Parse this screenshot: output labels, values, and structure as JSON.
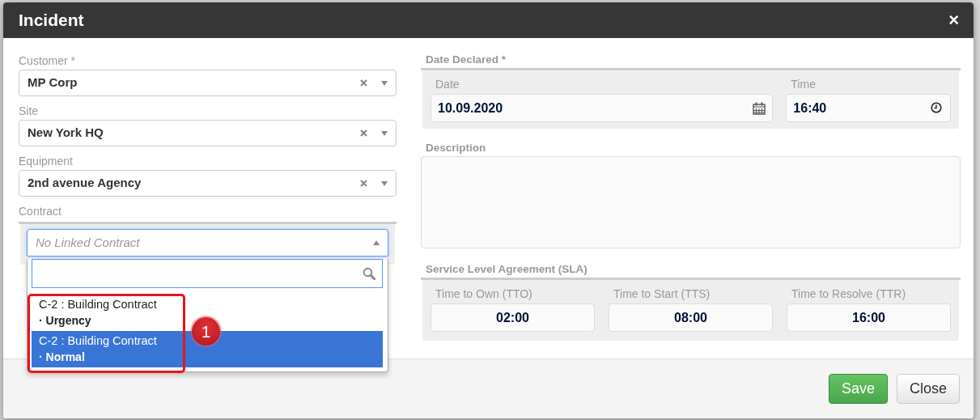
{
  "dialog": {
    "title": "Incident",
    "close_glyph": "×"
  },
  "left_fields": [
    {
      "label": "Customer *",
      "value": "MP Corp"
    },
    {
      "label": "Site",
      "value": "New York HQ"
    },
    {
      "label": "Equipment",
      "value": "2nd avenue Agency"
    }
  ],
  "contract": {
    "label": "Contract",
    "placeholder": "No Linked Contract",
    "expanded": true,
    "options": [
      {
        "name": "C-2 : Building Contract",
        "priority": "· Urgency",
        "selected": false
      },
      {
        "name": "C-2 : Building Contract",
        "priority": "· Normal",
        "selected": true
      }
    ]
  },
  "date_declared": {
    "label": "Date Declared *",
    "date": {
      "label": "Date",
      "value": "10.09.2020"
    },
    "time": {
      "label": "Time",
      "value": "16:40"
    }
  },
  "description": {
    "label": "Description"
  },
  "sla": {
    "label": "Service Level Agreement (SLA)",
    "fields": [
      {
        "label": "Time to Own (TTO)",
        "value": "02:00"
      },
      {
        "label": "Time to Start (TTS)",
        "value": "08:00"
      },
      {
        "label": "Time to Resolve (TTR)",
        "value": "16:00"
      }
    ]
  },
  "callout": {
    "number": "1"
  },
  "buttons": [
    {
      "label": "Save",
      "kind": "primary"
    },
    {
      "label": "Close",
      "kind": "secondary"
    }
  ]
}
